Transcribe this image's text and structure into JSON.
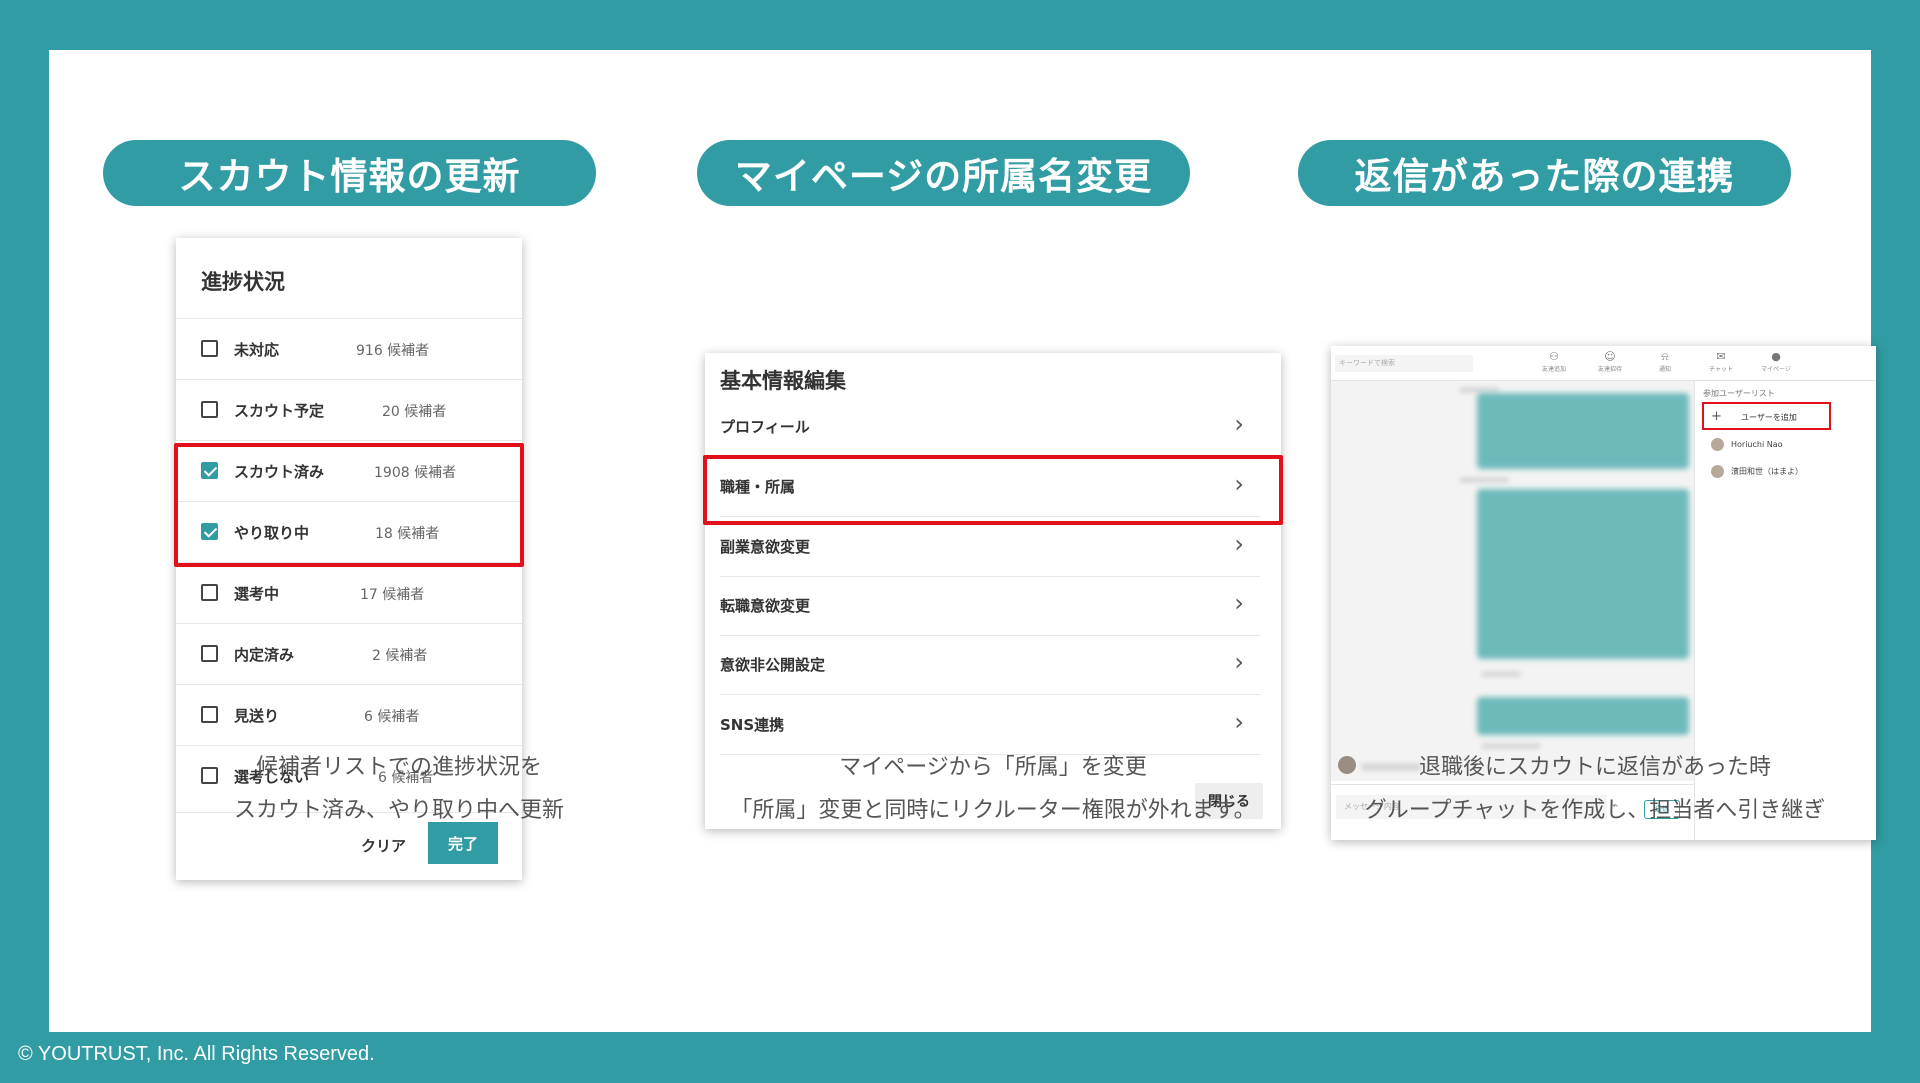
{
  "headings": [
    "スカウト情報の更新",
    "マイページの所属名変更",
    "返信があった際の連携"
  ],
  "panel1": {
    "title": "進捗状況",
    "rows": [
      {
        "label": "未対応",
        "count": "916 候補者",
        "checked": false
      },
      {
        "label": "スカウト予定",
        "count": "20 候補者",
        "checked": false
      },
      {
        "label": "スカウト済み",
        "count": "1908 候補者",
        "checked": true
      },
      {
        "label": "やり取り中",
        "count": "18 候補者",
        "checked": true
      },
      {
        "label": "選考中",
        "count": "17 候補者",
        "checked": false
      },
      {
        "label": "内定済み",
        "count": "2 候補者",
        "checked": false
      },
      {
        "label": "見送り",
        "count": "6 候補者",
        "checked": false
      },
      {
        "label": "選考しない",
        "count": "6 候補者",
        "checked": false
      }
    ],
    "clear_label": "クリア",
    "done_label": "完了"
  },
  "panel2": {
    "title": "基本情報編集",
    "items": [
      "プロフィール",
      "職種・所属",
      "副業意欲変更",
      "転職意欲変更",
      "意欲非公開設定",
      "SNS連携"
    ],
    "close_label": "閉じる"
  },
  "panel3": {
    "search_placeholder": "キーワードで検索",
    "nav": [
      {
        "label": "友達追加",
        "icon": "add-friend-icon"
      },
      {
        "label": "友達招待",
        "icon": "smile-icon"
      },
      {
        "label": "通知",
        "icon": "bell-icon"
      },
      {
        "label": "チャット",
        "icon": "mail-icon"
      },
      {
        "label": "マイページ",
        "icon": "avatar"
      }
    ],
    "members_title": "参加ユーザーリスト",
    "add_user_label": "ユーザーを追加",
    "members": [
      "Horiuchi Nao",
      "濱田和世（はまよ）"
    ],
    "message_placeholder": "メッセージ内容",
    "send_label": "送信"
  },
  "captions": [
    [
      "候補者リストでの進捗状況を",
      "スカウト済み、やり取り中へ更新"
    ],
    [
      "マイページから「所属」を変更",
      "「所属」変更と同時にリクルーター権限が外れます。"
    ],
    [
      "退職後にスカウトに返信があった時",
      "グループチャットを作成し、担当者へ引き継ぎ"
    ]
  ],
  "footer": "© YOUTRUST, Inc. All Rights Reserved.",
  "colors": {
    "teal": "#319ca3",
    "highlight_red": "#e1111b"
  }
}
